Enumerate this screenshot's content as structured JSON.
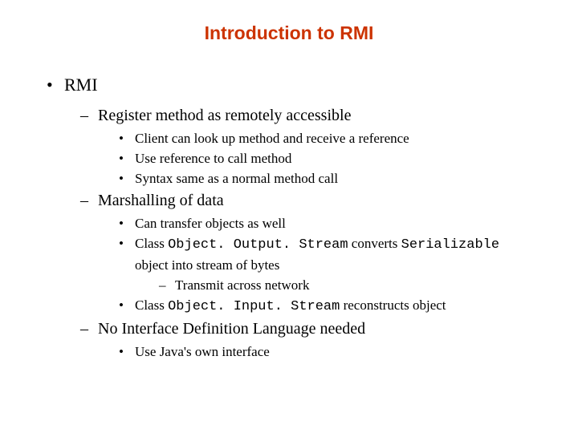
{
  "title": "Introduction to RMI",
  "l1": {
    "a": "RMI"
  },
  "l2": {
    "a": "Register method as remotely accessible",
    "b": "Marshalling of data",
    "c": "No Interface Definition Language needed"
  },
  "l3": {
    "a1": "Client can look up method and receive a reference",
    "a2": "Use reference to call method",
    "a3": "Syntax same as a normal method call",
    "b1": "Can transfer objects as well",
    "b2_pre": "Class ",
    "b2_code": "Object. Output. Stream",
    "b2_post": " converts ",
    "b2_code2": "Serializable",
    "b2_cont": "object into stream of bytes",
    "b3_pre": "Class ",
    "b3_code": "Object. Input. Stream",
    "b3_post": " reconstructs object",
    "c1": "Use Java's own interface"
  },
  "l4": {
    "a": "Transmit across network"
  }
}
